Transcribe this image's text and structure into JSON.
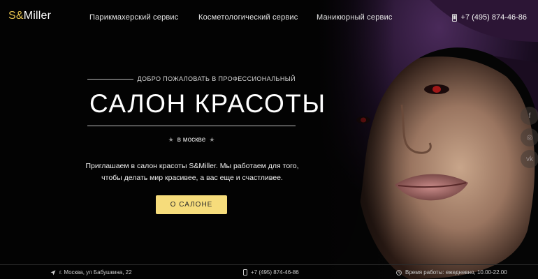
{
  "brand": {
    "logo_part1": "S&",
    "logo_part2": "Miller",
    "accent_color": "#e2bf4d"
  },
  "nav": {
    "items": [
      {
        "label": "Парикмахерский сервис"
      },
      {
        "label": "Косметологический сервис"
      },
      {
        "label": "Маникюрный сервис"
      }
    ],
    "phone": "+7 (495) 874-46-86",
    "phone_icon": "phone-icon"
  },
  "hero": {
    "welcome": "ДОБРО ПОЖАЛОВАТЬ В ПРОФЕССИОНАЛЬНЫЙ",
    "title": "САЛОН КРАСОТЫ",
    "city": "в москве",
    "description_line1": "Приглашаем в салон красоты S&Miller. Мы работаем для того,",
    "description_line2": "чтобы делать мир красивее, а вас еще и счастливее.",
    "cta_label": "О САЛОНЕ",
    "cta_color": "#f6dc7b"
  },
  "social": {
    "items": [
      {
        "name": "facebook",
        "glyph": "f"
      },
      {
        "name": "instagram",
        "glyph": "◎"
      },
      {
        "name": "vk",
        "glyph": "vk"
      }
    ]
  },
  "footer": {
    "address": "г. Москва, ул Бабушкина, 22",
    "address_icon": "location-arrow-icon",
    "phone": "+7 (495) 874-46-86",
    "phone_icon": "phone-icon",
    "hours": "Время работы: ежедневно, 10.00-22.00",
    "hours_icon": "clock-icon"
  }
}
